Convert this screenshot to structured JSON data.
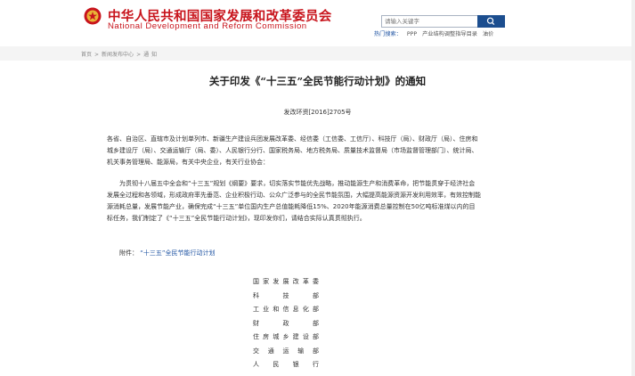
{
  "header": {
    "org_cn": "中华人民共和国国家发展和改革委员会",
    "org_en": "National Development and Reform Commission",
    "search_placeholder": "请输入关键字",
    "hot_search_label": "热门搜索：",
    "hot_search_items": [
      "PPP",
      "产业结构调整指导目录",
      "油价"
    ]
  },
  "breadcrumb": [
    "首页",
    ">",
    "新闻发布中心",
    ">",
    "通",
    "知"
  ],
  "article": {
    "title": "关于印发《“十三五”全民节能行动计划》的通知",
    "doc_no": "发改环资[2016]2705号",
    "addressees": "各省、自治区、直辖市及计划单列市、新疆生产建设兵团发展改革委、经信委（工信委、工信厅）、科技厅（局）、财政厅（局）、住房和城乡建设厅（局）、交通运输厅（局、委）、人民银行分行、国家税务局、地方税务局、质量技术监督局（市场监督管理部门）、统计局、机关事务管理局、能源局，有关中央企业，有关行业协会：",
    "body": "为贯彻十八届五中全会和“十三五”规划《纲要》要求，切实落实节能优先战略，推动能源生产和消费革命，把节能贯穿于经济社会发展全过程和各领域，形成政府率先垂范、企业积极行动、公众广泛参与的全民节能氛围，大幅提高能源资源开发利用效率，有效控制能源消耗总量，发展节能产业，确保完成“十三五”单位国内生产总值能耗降低15%、2020年能源消费总量控制在50亿吨标准煤以内的目标任务，我们制定了《“十三五”全民节能行动计划》，现印发你们，请结合实际认真贯彻执行。",
    "attachment_label": "附件：",
    "attachment_link": "“十三五”全民节能行动计划",
    "signatories": [
      "国家发展改革委",
      "科 技 部",
      "工业和信息化部",
      "财 政 部",
      "住房城乡建设部",
      "交 通 运 输 部",
      "人 民 银 行"
    ]
  },
  "colors": {
    "brand_red": "#c8141c",
    "link_blue": "#2054a3",
    "search_button": "#1c4e8f"
  }
}
